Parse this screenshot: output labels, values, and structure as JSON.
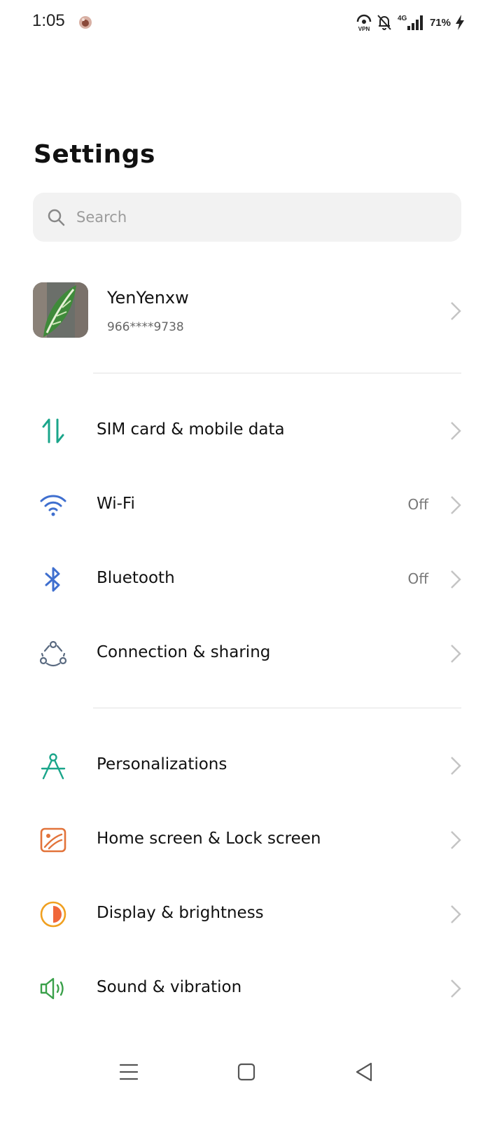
{
  "status_bar": {
    "time": "1:05",
    "battery": "71%",
    "network": "4G",
    "vpn": "VPN"
  },
  "page": {
    "title": "Settings"
  },
  "search": {
    "placeholder": "Search"
  },
  "account": {
    "name": "YenYenxw",
    "phone": "966****9738"
  },
  "settings": [
    {
      "label": "SIM card & mobile data",
      "status": "",
      "icon": "sim-data-icon",
      "color": "#1aa58a"
    },
    {
      "label": "Wi-Fi",
      "status": "Off",
      "icon": "wifi-icon",
      "color": "#3f6fcf"
    },
    {
      "label": "Bluetooth",
      "status": "Off",
      "icon": "bluetooth-icon",
      "color": "#3f6fcf"
    },
    {
      "label": "Connection & sharing",
      "status": "",
      "icon": "connection-sharing-icon",
      "color": "#5a6a80"
    },
    {
      "label": "Personalizations",
      "status": "",
      "icon": "personalization-compass-icon",
      "color": "#1aa58a"
    },
    {
      "label": "Home screen & Lock screen",
      "status": "",
      "icon": "home-lock-screen-icon",
      "color": "#e2733a"
    },
    {
      "label": "Display & brightness",
      "status": "",
      "icon": "display-brightness-icon",
      "color": "#f0a020"
    },
    {
      "label": "Sound & vibration",
      "status": "",
      "icon": "sound-vibration-icon",
      "color": "#3aa04a"
    }
  ]
}
